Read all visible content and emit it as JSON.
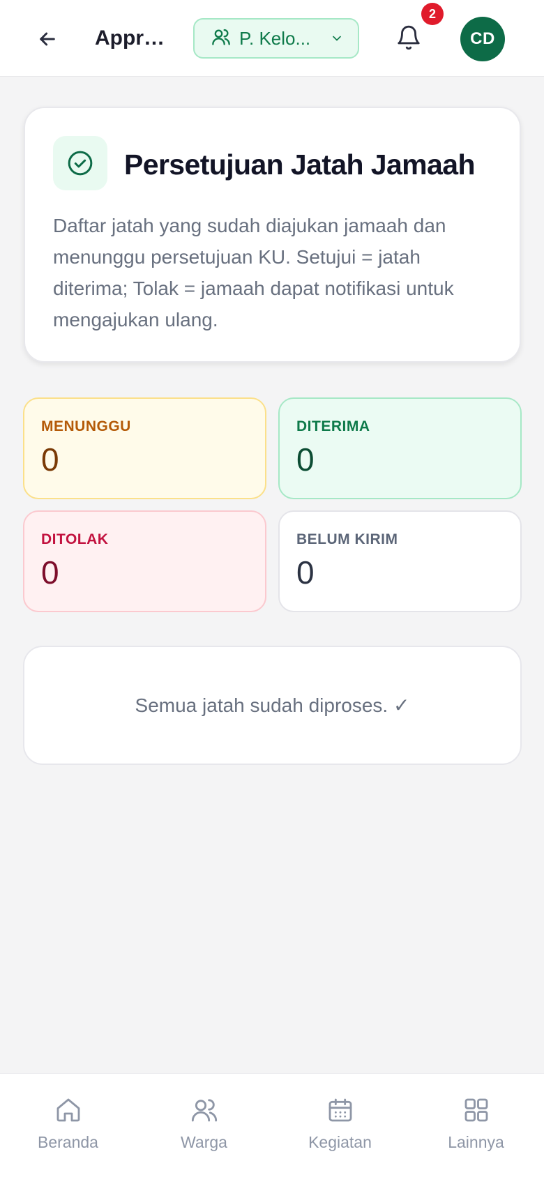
{
  "header": {
    "back_icon": "arrow-left-icon",
    "title": "Appro...",
    "group_select": {
      "icon": "users-icon",
      "value": "P. Kelo...",
      "chevron": "chevron-down-icon"
    },
    "notifications": {
      "icon": "bell-icon",
      "count": "2"
    },
    "avatar_initials": "CD"
  },
  "intro": {
    "icon": "check-circle-icon",
    "title": "Persetujuan Jatah Jamaah",
    "description": "Daftar jatah yang sudah diajukan jamaah dan menunggu persetujuan KU. Setujui = jatah diterima; Tolak = jamaah dapat notifikasi untuk mengajukan ulang."
  },
  "stats": {
    "pending": {
      "label": "MENUNGGU",
      "value": "0"
    },
    "approved": {
      "label": "DITERIMA",
      "value": "0"
    },
    "rejected": {
      "label": "DITOLAK",
      "value": "0"
    },
    "not_sent": {
      "label": "BELUM KIRIM",
      "value": "0"
    }
  },
  "empty_state": {
    "message": "Semua jatah sudah diproses. ✓"
  },
  "bottom_nav": [
    {
      "label": "Beranda",
      "icon": "home-icon"
    },
    {
      "label": "Warga",
      "icon": "users-icon"
    },
    {
      "label": "Kegiatan",
      "icon": "calendar-icon"
    },
    {
      "label": "Lainnya",
      "icon": "grid-icon"
    }
  ],
  "colors": {
    "brand_green": "#0d6b47",
    "accent_green_bg": "#e9faf1",
    "badge_red": "#e01b2b",
    "pending_bg": "#fffbea",
    "rejected_bg": "#fff1f2"
  }
}
